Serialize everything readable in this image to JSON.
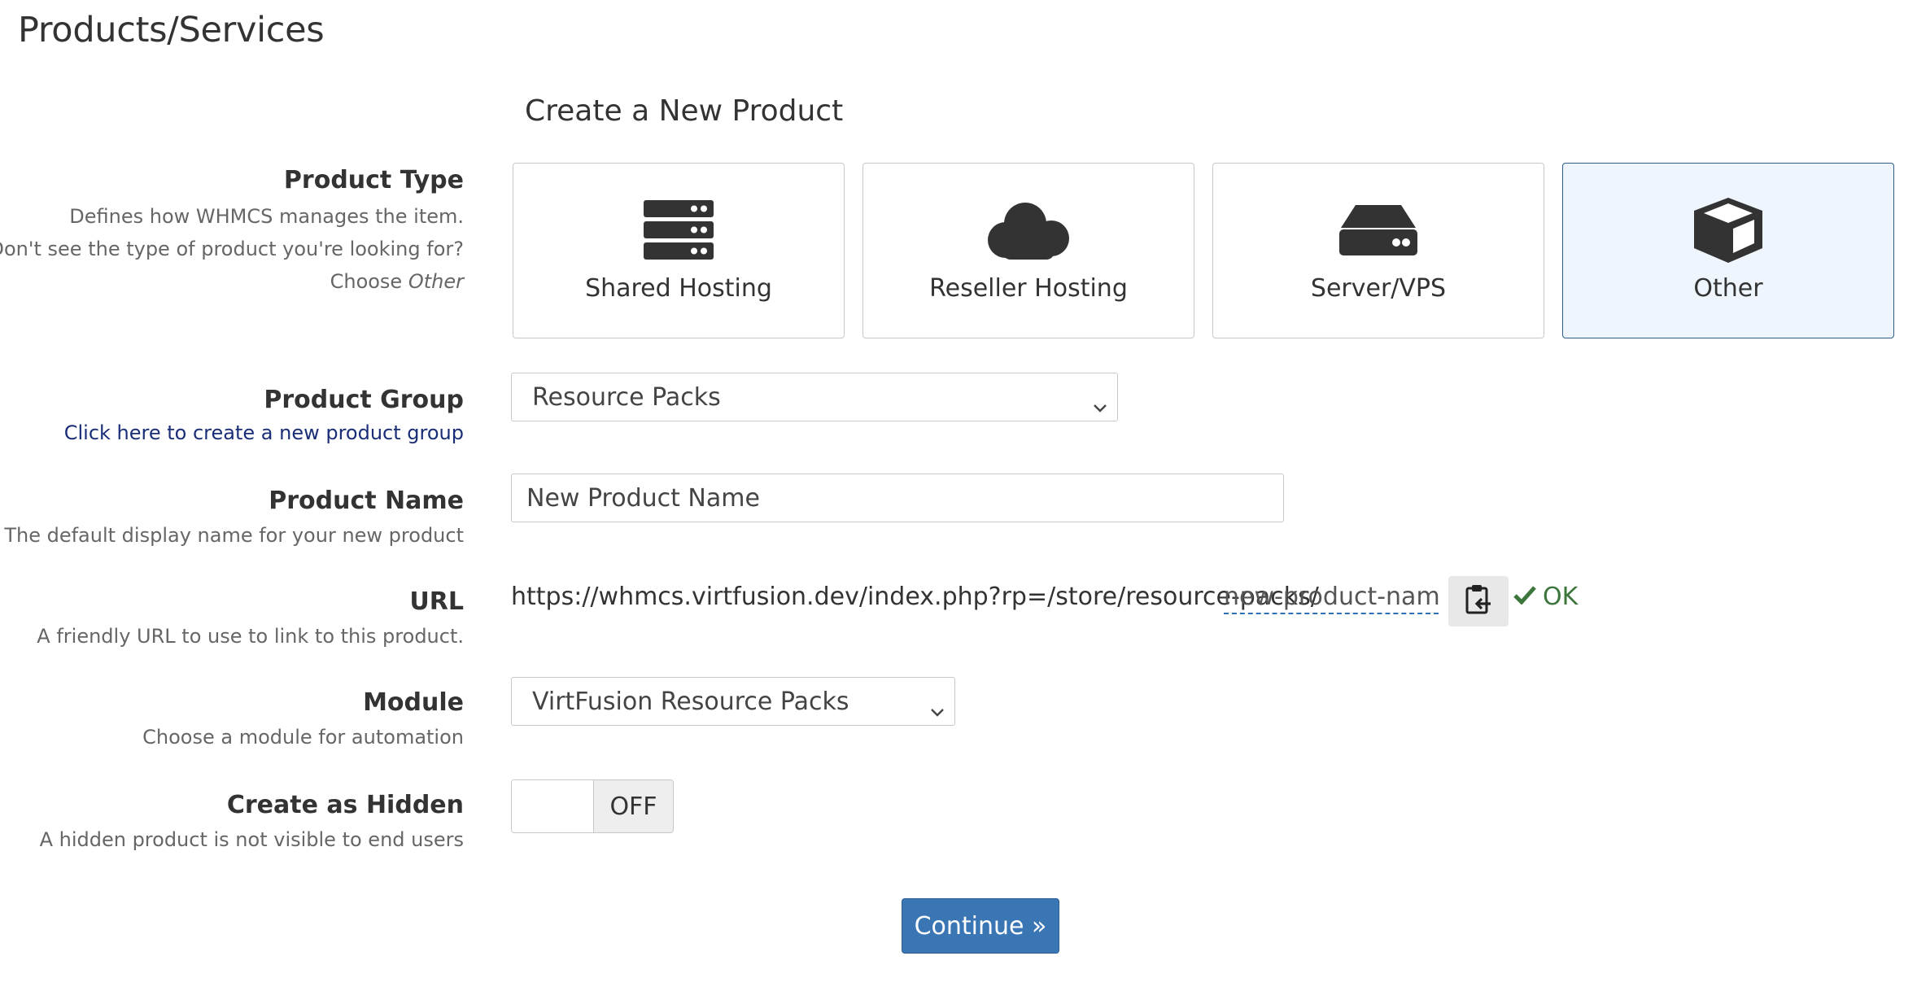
{
  "page": {
    "title": "Products/Services"
  },
  "form": {
    "section_title": "Create a New Product",
    "product_type": {
      "label": "Product Type",
      "hint_1": "Defines how WHMCS manages the item.",
      "hint_2": "Don't see the type of product you're looking for?",
      "hint_3_prefix": "Choose",
      "hint_3_emph": "Other",
      "options": [
        {
          "label": "Shared Hosting",
          "icon": "server-stack-icon",
          "selected": false
        },
        {
          "label": "Reseller Hosting",
          "icon": "cloud-icon",
          "selected": false
        },
        {
          "label": "Server/VPS",
          "icon": "hdd-icon",
          "selected": false
        },
        {
          "label": "Other",
          "icon": "cube-icon",
          "selected": true
        }
      ]
    },
    "product_group": {
      "label": "Product Group",
      "link": "Click here to create a new product group",
      "selected": "Resource Packs"
    },
    "product_name": {
      "label": "Product Name",
      "hint": "The default display name for your new product",
      "value": "New Product Name"
    },
    "url": {
      "label": "URL",
      "hint": "A friendly URL to use to link to this product.",
      "prefix": "https://whmcs.virtfusion.dev/index.php?rp=/store/resource-packs/",
      "slug": "new-product-name",
      "status": "OK"
    },
    "module": {
      "label": "Module",
      "hint": "Choose a module for automation",
      "selected": "VirtFusion Resource Packs"
    },
    "hidden": {
      "label": "Create as Hidden",
      "hint": "A hidden product is not visible to end users",
      "state": "OFF"
    },
    "continue_label": "Continue »"
  },
  "colors": {
    "primary_button": "#3a75b4",
    "selected_card_bg": "#eef5fd",
    "selected_card_border": "#2f5b8a",
    "ok_green": "#3c763d",
    "link": "#1a2e78"
  }
}
